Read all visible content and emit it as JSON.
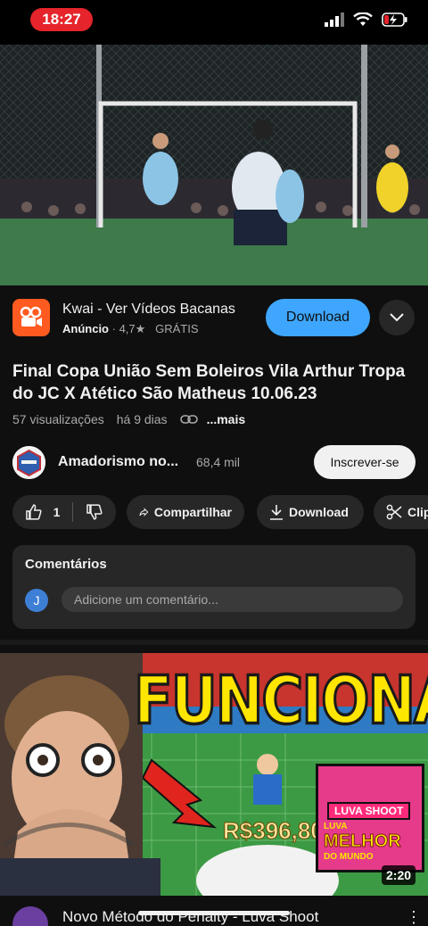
{
  "status_bar": {
    "time": "18:27"
  },
  "ad": {
    "title": "Kwai - Ver Vídeos Bacanas",
    "label": "Anúncio",
    "rating": "4,7★",
    "price": "GRÁTIS",
    "download_label": "Download"
  },
  "video": {
    "title": "Final Copa União Sem Boleiros Vila Arthur Tropa do JC X Atético São Matheus 10.06.23",
    "views": "57 visualizações",
    "age": "há 9 dias",
    "more": "...mais"
  },
  "channel": {
    "name": "Amadorismo no...",
    "subscribers": "68,4 mil",
    "subscribe_label": "Inscrever-se"
  },
  "actions": {
    "like_count": "1",
    "share_label": "Compartilhar",
    "download_label": "Download",
    "clip_label": "Clip"
  },
  "comments": {
    "title": "Comentários",
    "avatar_letter": "J",
    "placeholder": "Adicione um comentário..."
  },
  "next_video": {
    "headline": "FUNCIONA?",
    "money": "R$396,80",
    "inset_tag": "LUVA SHOOT",
    "inset_line1": "LUVA",
    "inset_line2": "MELHOR",
    "inset_line3": "DO MUNDO",
    "duration": "2:20",
    "title": "Novo Método do Penalty - Luva Shoot"
  },
  "colors": {
    "accent": "#3ea6ff",
    "time_pill": "#e5242b",
    "kwai": "#ff5a1f"
  }
}
